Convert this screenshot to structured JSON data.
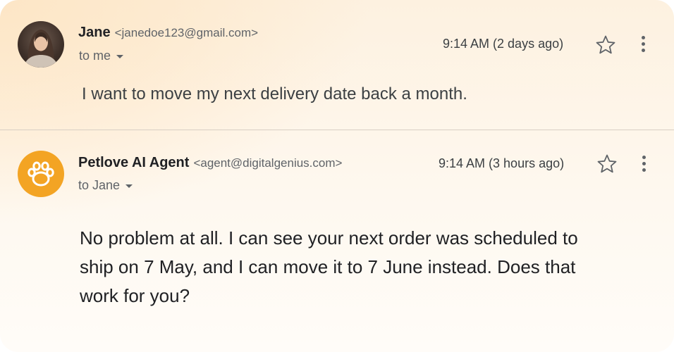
{
  "messages": [
    {
      "sender_name": "Jane",
      "sender_email": "<janedoe123@gmail.com>",
      "recipient": "to me",
      "timestamp": "9:14 AM (2 days ago)",
      "avatar_icon": "person-photo",
      "body": "I want to move my next delivery date back a month."
    },
    {
      "sender_name": "Petlove AI Agent",
      "sender_email": "<agent@digitalgenius.com>",
      "recipient": "to Jane",
      "timestamp": "9:14 AM (3 hours ago)",
      "avatar_icon": "paw-icon",
      "avatar_color": "#f3a424",
      "body": "No problem at all. I can see your next order was scheduled to ship on 7 May, and I can move it to 7 June instead. Does that work for you?"
    }
  ],
  "icons": {
    "star": "star-outline-icon",
    "more": "vertical-dots-icon",
    "recipient_toggle": "caret-down-icon"
  }
}
